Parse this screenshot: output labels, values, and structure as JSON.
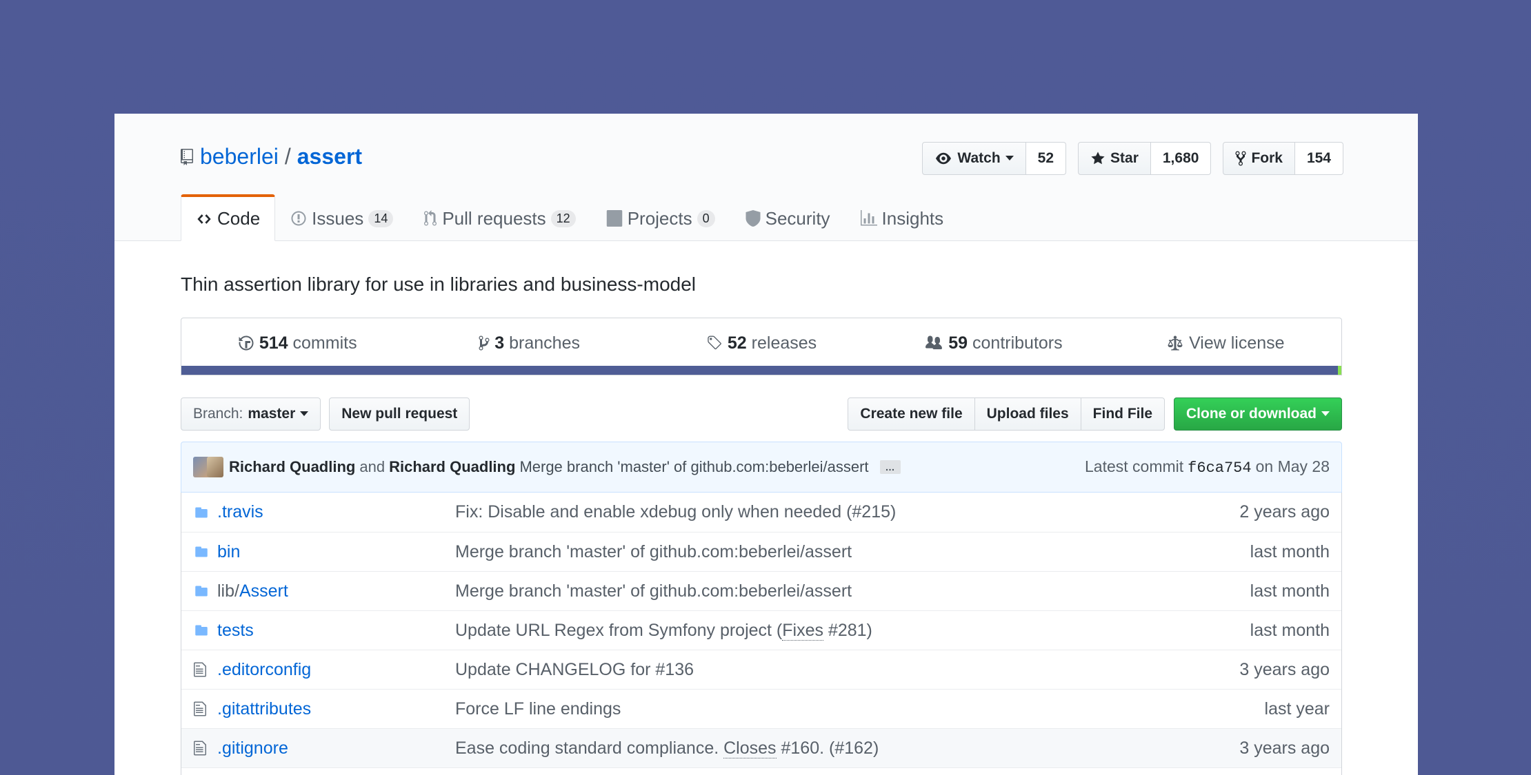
{
  "repo": {
    "owner": "beberlei",
    "separator": "/",
    "name": "assert",
    "description": "Thin assertion library for use in libraries and business-model"
  },
  "actions": {
    "watch_label": "Watch",
    "watch_count": "52",
    "star_label": "Star",
    "star_count": "1,680",
    "fork_label": "Fork",
    "fork_count": "154"
  },
  "tabs": [
    {
      "label": "Code",
      "icon": "code-icon"
    },
    {
      "label": "Issues",
      "counter": "14",
      "icon": "issue-icon"
    },
    {
      "label": "Pull requests",
      "counter": "12",
      "icon": "pull-request-icon"
    },
    {
      "label": "Projects",
      "counter": "0",
      "icon": "project-icon"
    },
    {
      "label": "Security",
      "icon": "shield-icon"
    },
    {
      "label": "Insights",
      "icon": "graph-icon"
    }
  ],
  "summary": {
    "commits_num": "514",
    "commits_label": "commits",
    "branches_num": "3",
    "branches_label": "branches",
    "releases_num": "52",
    "releases_label": "releases",
    "contributors_num": "59",
    "contributors_label": "contributors",
    "license_label": "View license"
  },
  "language_colors": {
    "primary": "#4f5d95",
    "secondary": "#89e051"
  },
  "filebar": {
    "branch_prefix": "Branch:",
    "branch_name": "master",
    "new_pr": "New pull request",
    "create_file": "Create new file",
    "upload_files": "Upload files",
    "find_file": "Find File",
    "clone": "Clone or download"
  },
  "commit": {
    "author1": "Richard Quadling",
    "and": "and",
    "author2": "Richard Quadling",
    "message": "Merge branch 'master' of github.com:beberlei/assert",
    "ellipsis": "…",
    "latest_label": "Latest commit",
    "sha": "f6ca754",
    "date": "on May 28"
  },
  "files": [
    {
      "type": "dir",
      "name": ".travis",
      "message": "Fix: Disable and enable xdebug only when needed (#215)",
      "age": "2 years ago"
    },
    {
      "type": "dir",
      "name": "bin",
      "message": "Merge branch 'master' of github.com:beberlei/assert",
      "age": "last month"
    },
    {
      "type": "dir",
      "prefix": "lib/",
      "name": "Assert",
      "message": "Merge branch 'master' of github.com:beberlei/assert",
      "age": "last month"
    },
    {
      "type": "dir",
      "name": "tests",
      "msg_pre": "Update URL Regex from Symfony project (",
      "msg_u": "Fixes",
      "msg_post": " #281)",
      "age": "last month"
    },
    {
      "type": "file",
      "name": ".editorconfig",
      "message": "Update CHANGELOG for #136",
      "age": "3 years ago"
    },
    {
      "type": "file",
      "name": ".gitattributes",
      "message": "Force LF line endings",
      "age": "last year"
    },
    {
      "type": "file",
      "name": ".gitignore",
      "msg_pre": "Ease coding standard compliance. ",
      "msg_u": "Closes",
      "msg_post": " #160. (#162)",
      "age": "3 years ago"
    }
  ]
}
